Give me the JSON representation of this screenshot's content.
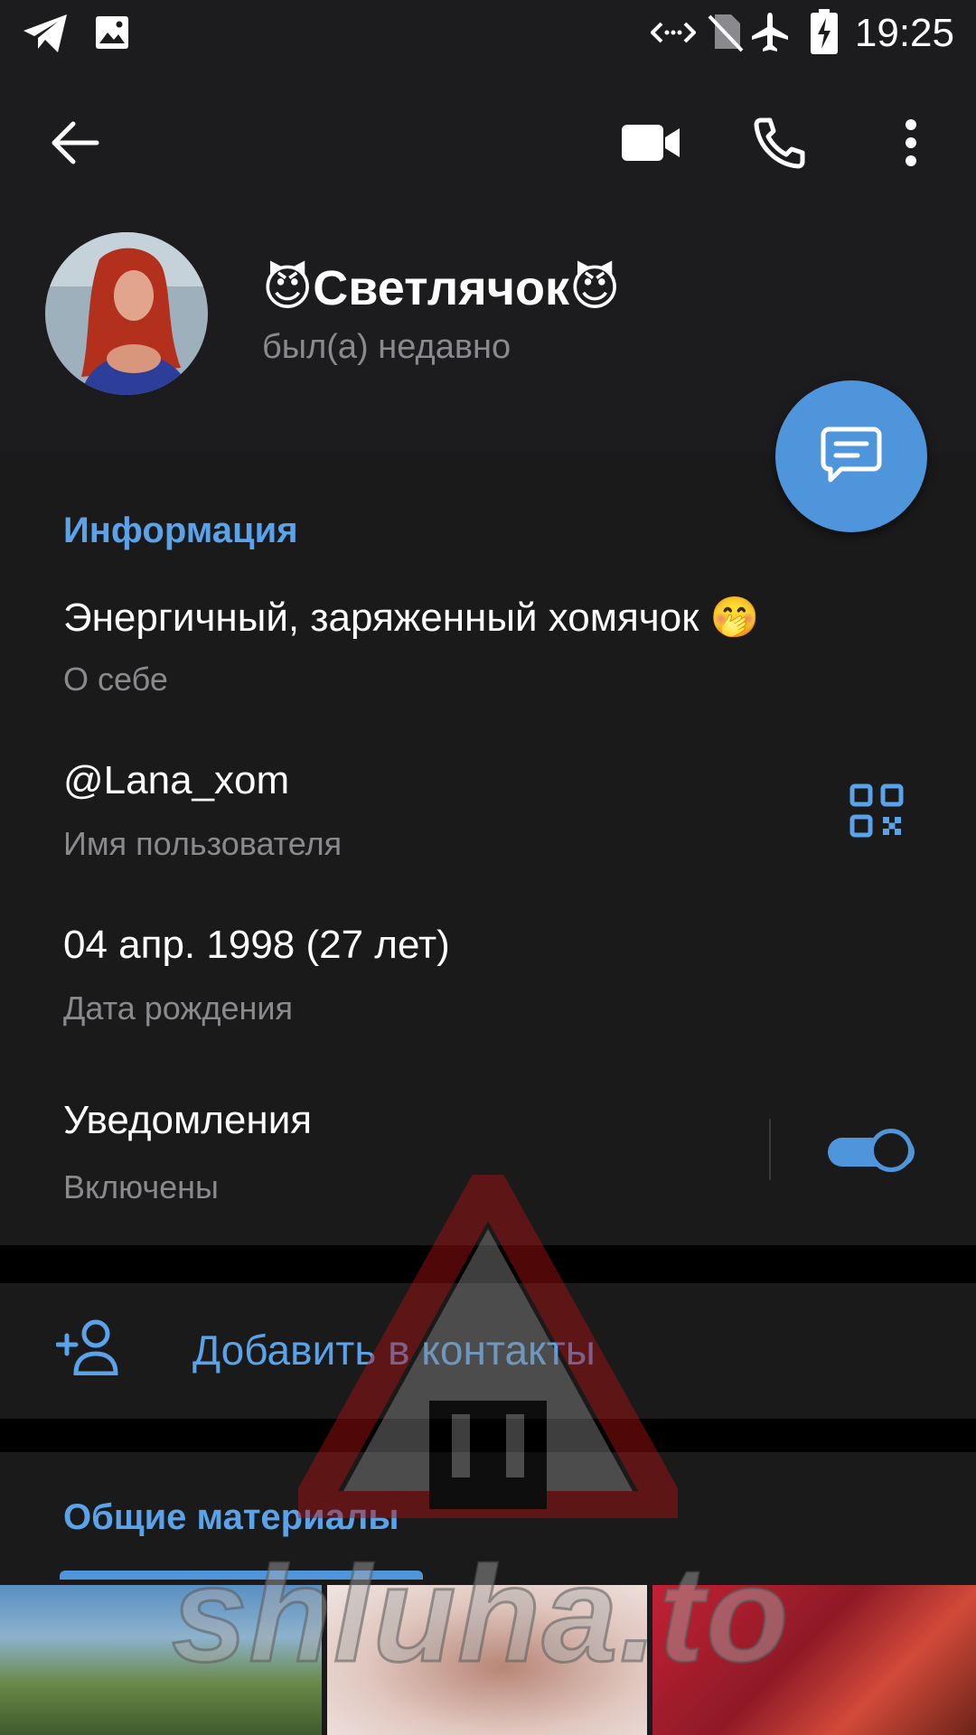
{
  "status_bar": {
    "time": "19:25",
    "left_icons": [
      "telegram-icon",
      "image-icon"
    ],
    "right_icons": [
      "data-saver-icon",
      "no-sim-icon",
      "airplane-mode-icon",
      "battery-charging-icon"
    ]
  },
  "app_bar": {
    "back_icon": "back-arrow-icon",
    "actions": [
      "video-call-icon",
      "phone-icon",
      "more-vert-icon"
    ]
  },
  "profile": {
    "name": "😈Светлячок😈",
    "last_seen": "был(а) недавно"
  },
  "fab_icon": "message-icon",
  "info_section": {
    "title": "Информация",
    "bio": {
      "value": "Энергичный, заряженный хомячок 🤭",
      "label": "О себе"
    },
    "username": {
      "value": "@Lana_xom",
      "label": "Имя пользователя",
      "icon": "qr-code-icon"
    },
    "birthday": {
      "value": "04 апр. 1998 (27 лет)",
      "label": "Дата рождения"
    },
    "notifications": {
      "value": "Уведомления",
      "label": "Включены",
      "enabled": true
    }
  },
  "add_contact": {
    "label": "Добавить в контакты",
    "icon": "add-person-icon"
  },
  "shared_media": {
    "title": "Общие материалы"
  },
  "watermark": {
    "text": "shluha.to"
  },
  "colors": {
    "accent": "#5aa3ea",
    "fab": "#4f95db",
    "background": "#1a1a1a",
    "header": "#1c1c1e"
  }
}
